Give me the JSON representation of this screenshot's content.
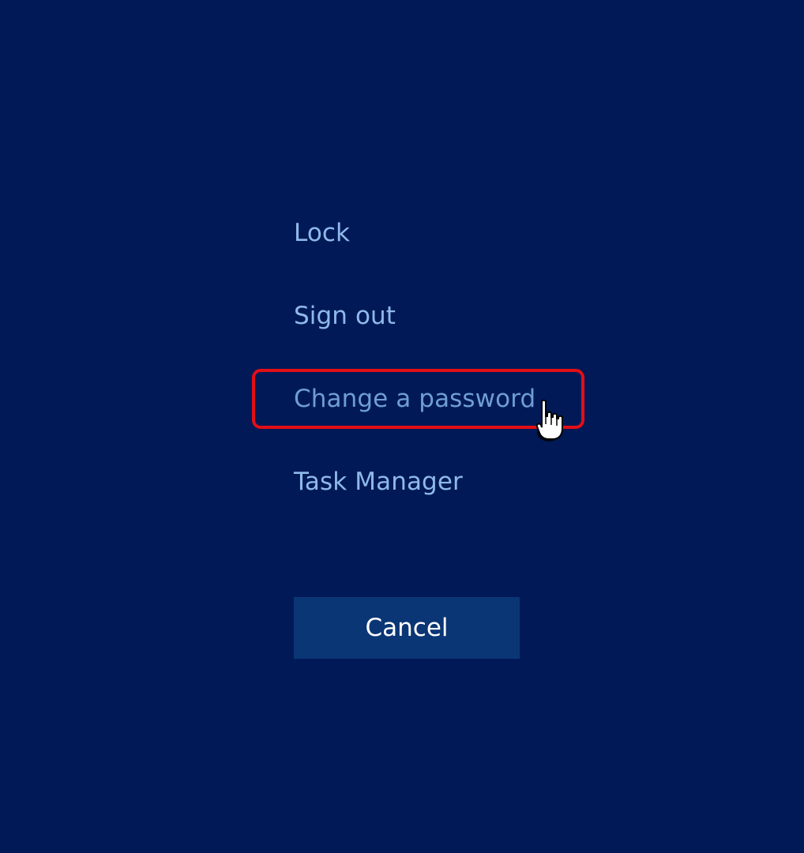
{
  "menu": {
    "items": [
      {
        "label": "Lock"
      },
      {
        "label": "Sign out"
      },
      {
        "label": "Change a password"
      },
      {
        "label": "Task Manager"
      }
    ]
  },
  "cancel_label": "Cancel",
  "colors": {
    "background": "#011a57",
    "link_text": "#8fb9ea",
    "hovered_link_text": "#6f9dd4",
    "cancel_button_bg": "#0b3675",
    "highlight_border": "#e30e16"
  },
  "icons": {
    "pointer": "hand-pointer-icon"
  }
}
